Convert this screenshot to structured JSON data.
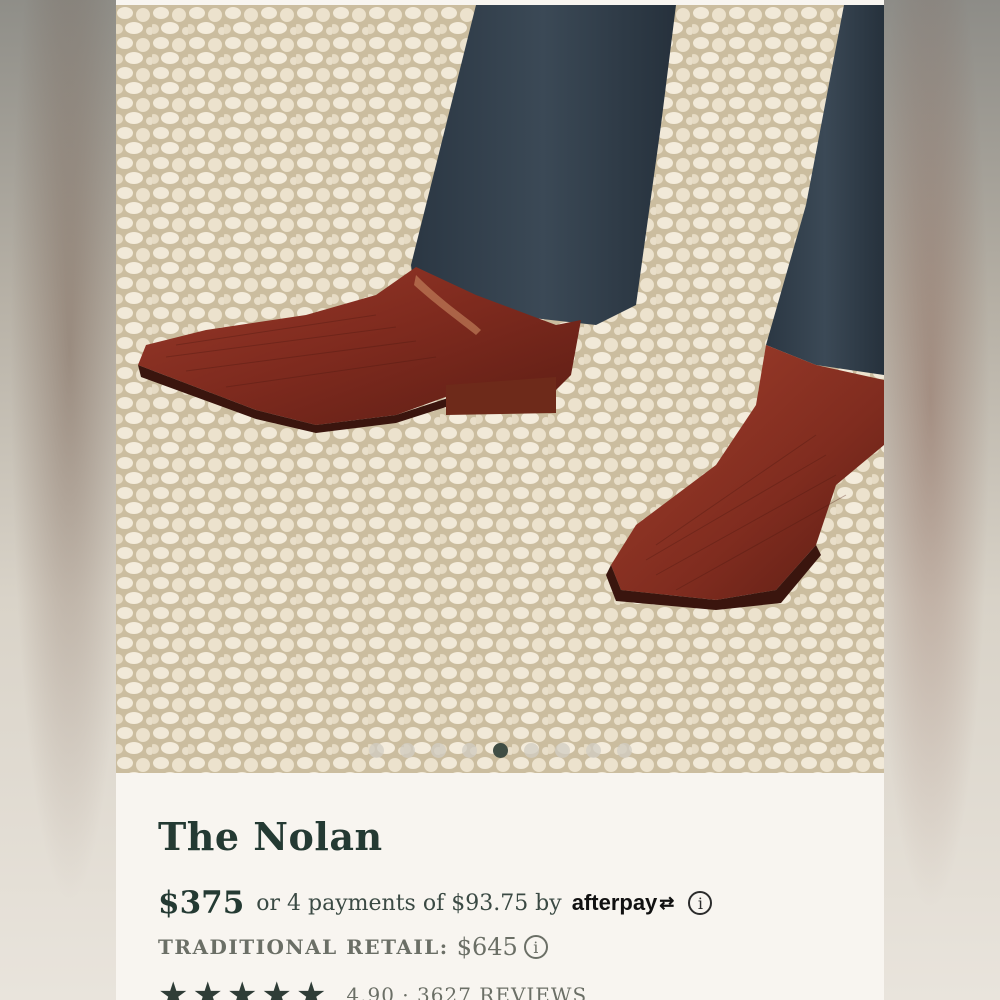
{
  "product": {
    "title": "The Nolan",
    "price": "$375",
    "installments_text": "or 4 payments of $93.75 by",
    "afterpay_label": "afterpay",
    "retail_label": "TRADITIONAL RETAIL:",
    "retail_price": "$645",
    "rating_stars": 5,
    "reviews_text": "4.90 · 3627 REVIEWS"
  },
  "gallery": {
    "slide_count": 9,
    "active_index": 4
  },
  "icons": {
    "info": "info-circle-icon",
    "afterpay": "afterpay-arrows-icon",
    "star": "star-icon"
  },
  "colors": {
    "title_text": "#243a33",
    "muted_text": "#6b6f66",
    "active_dot": "#3f4d44",
    "card_background": "#f8f5f0"
  }
}
